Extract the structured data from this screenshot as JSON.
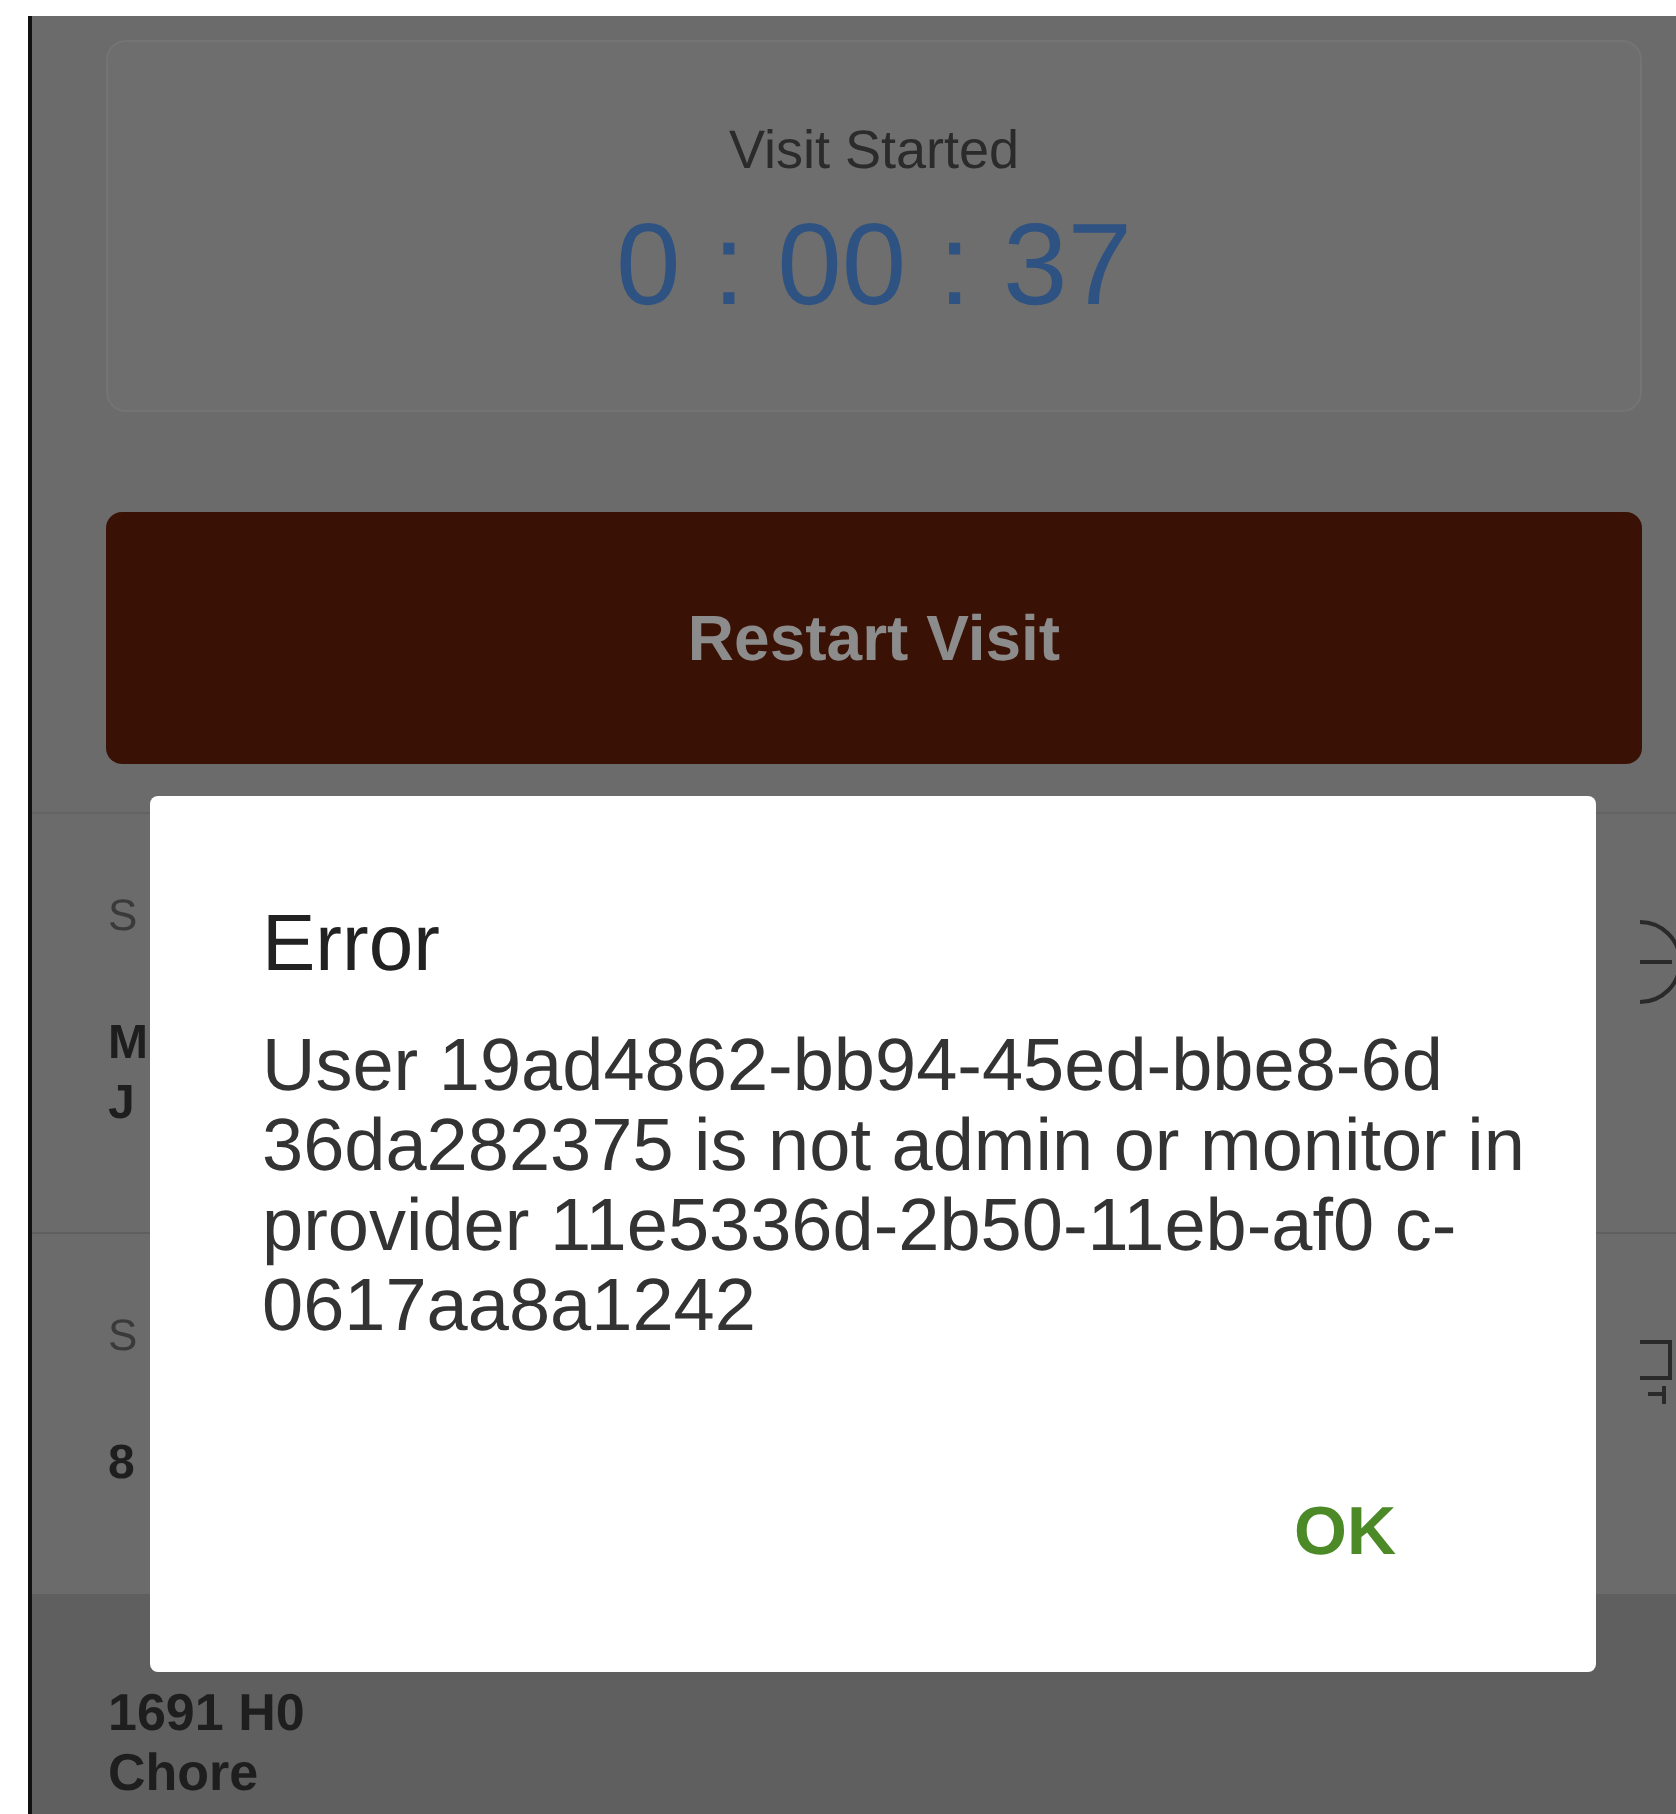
{
  "visit": {
    "label": "Visit Started",
    "elapsed": "0 : 00 : 37"
  },
  "restart_button": "Restart Visit",
  "details": [
    {
      "label": "S",
      "lines": [
        "M",
        "J"
      ],
      "kind": "minus-circle"
    },
    {
      "label": "S",
      "lines": [
        "8"
      ],
      "kind": "square"
    }
  ],
  "service": {
    "lines": [
      "1691 H0",
      "Chore"
    ]
  },
  "dialog": {
    "title": "Error",
    "message": "User 19ad4862-bb94-45ed-bbe8-6d 36da282375 is not admin or monitor in provider 11e5336d-2b50-11eb-af0 c-0617aa8a1242",
    "buttons": [
      "OK"
    ]
  }
}
